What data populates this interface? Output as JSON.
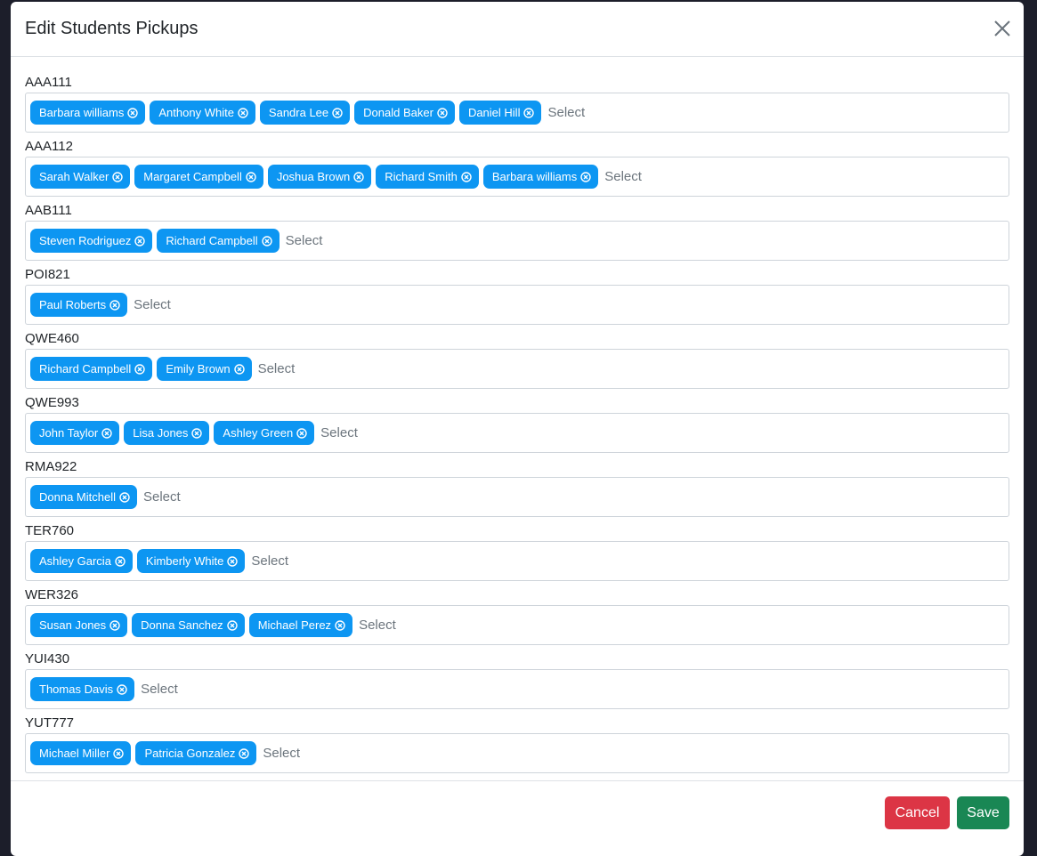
{
  "modal": {
    "title": "Edit Students Pickups",
    "placeholder": "Select",
    "cancel_label": "Cancel",
    "save_label": "Save"
  },
  "groups": [
    {
      "label": "AAA111",
      "chips": [
        "Barbara williams",
        "Anthony White",
        "Sandra Lee",
        "Donald Baker",
        "Daniel Hill"
      ]
    },
    {
      "label": "AAA112",
      "chips": [
        "Sarah Walker",
        "Margaret Campbell",
        "Joshua Brown",
        "Richard Smith",
        "Barbara williams"
      ]
    },
    {
      "label": "AAB111",
      "chips": [
        "Steven Rodriguez",
        "Richard Campbell"
      ]
    },
    {
      "label": "POI821",
      "chips": [
        "Paul Roberts"
      ]
    },
    {
      "label": "QWE460",
      "chips": [
        "Richard Campbell",
        "Emily Brown"
      ]
    },
    {
      "label": "QWE993",
      "chips": [
        "John Taylor",
        "Lisa Jones",
        "Ashley Green"
      ]
    },
    {
      "label": "RMA922",
      "chips": [
        "Donna Mitchell"
      ]
    },
    {
      "label": "TER760",
      "chips": [
        "Ashley Garcia",
        "Kimberly White"
      ]
    },
    {
      "label": "WER326",
      "chips": [
        "Susan Jones",
        "Donna Sanchez",
        "Michael Perez"
      ]
    },
    {
      "label": "YUI430",
      "chips": [
        "Thomas Davis"
      ]
    },
    {
      "label": "YUT777",
      "chips": [
        "Michael Miller",
        "Patricia Gonzalez"
      ]
    }
  ],
  "colors": {
    "chip": "#0d96f2",
    "cancel": "#dc3545",
    "save": "#198754"
  }
}
